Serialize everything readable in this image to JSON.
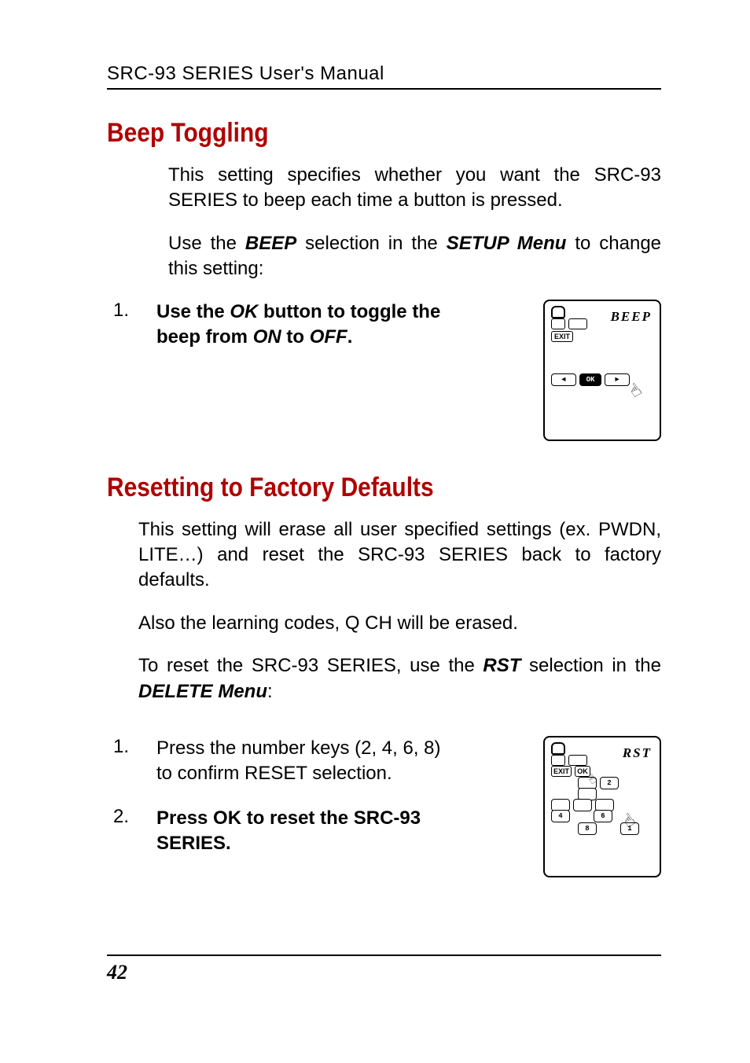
{
  "header": "SRC-93 SERIES User's Manual",
  "section1": {
    "title": "Beep Toggling",
    "p1_a": "This setting specifies whether you want the SRC-93 SERIES to beep each time a button is pressed.",
    "p2_a": "Use the ",
    "p2_b": "BEEP",
    "p2_c": " selection in the ",
    "p2_d": "SETUP Menu",
    "p2_e": " to change this setting:",
    "step1_num": "1.",
    "step1_a": "Use the ",
    "step1_b": "OK",
    "step1_c": " button to toggle the beep from ",
    "step1_d": "ON",
    "step1_e": " to ",
    "step1_f": "OFF",
    "step1_g": "."
  },
  "lcd1": {
    "title": "BEEP",
    "exit": "EXIT",
    "left": "◄",
    "ok": "OK",
    "right": "►"
  },
  "section2": {
    "title": "Resetting to Factory Defaults",
    "p1": "This setting will erase all user specified settings (ex. PWDN, LITE…) and reset the SRC-93 SERIES back to factory defaults.",
    "p2": "Also the learning codes, Q CH will be erased.",
    "p3_a": "To reset the SRC-93 SERIES, use the ",
    "p3_b": "RST",
    "p3_c": " selection in the ",
    "p3_d": "DELETE Menu",
    "p3_e": ":",
    "step1_num": "1.",
    "step1_text": "Press the number keys (2, 4, 6, 8) to confirm RESET selection.",
    "step2_num": "2.",
    "step2_text": "Press OK to reset the SRC-93 SERIES."
  },
  "lcd2": {
    "title": "RST",
    "exit": "EXIT",
    "ok": "OK",
    "k2": "2",
    "k4": "4",
    "k6": "6",
    "k8": "8",
    "k1": "1"
  },
  "page_number": "42"
}
